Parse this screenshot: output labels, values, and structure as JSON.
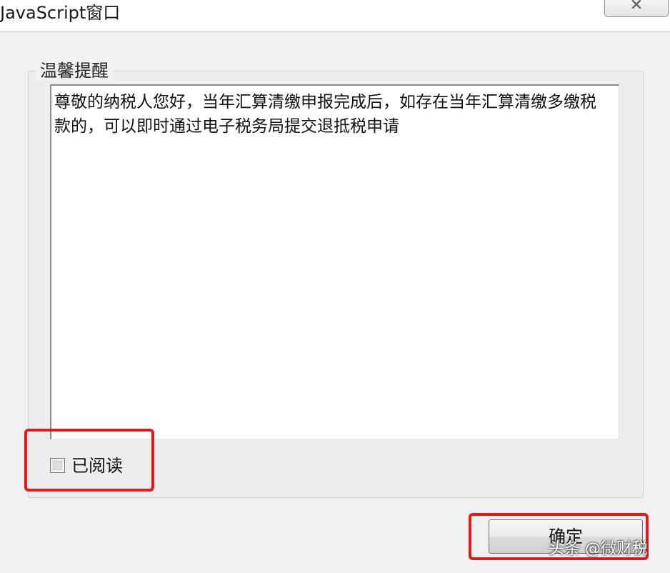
{
  "window": {
    "title": "JavaScript窗口",
    "close_symbol": "✕"
  },
  "group": {
    "label": "温馨提醒"
  },
  "message": {
    "text": "尊敬的纳税人您好，当年汇算清缴申报完成后，如存在当年汇算清缴多缴税款的，可以即时通过电子税务局提交退抵税申请"
  },
  "checkbox": {
    "label": "已阅读",
    "checked": false
  },
  "buttons": {
    "ok_label": "确定"
  },
  "watermark": {
    "text": "头条 @微财税"
  },
  "colors": {
    "highlight": "#e01919",
    "background": "#f1f1f1"
  }
}
